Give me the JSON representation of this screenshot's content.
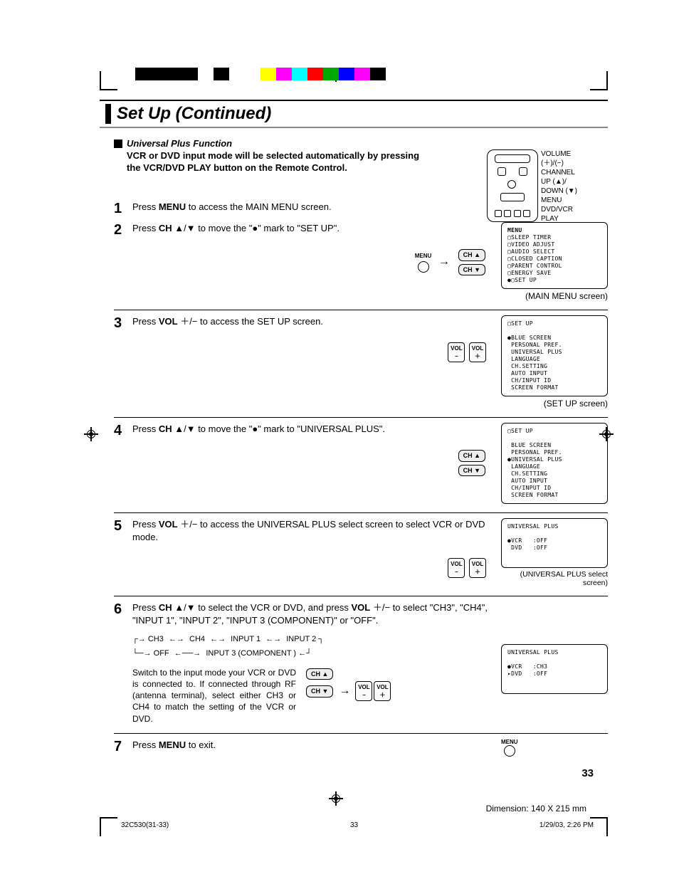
{
  "title": "Set Up (Continued)",
  "section": {
    "heading": "Universal Plus Function",
    "intro": "VCR or DVD input mode will be selected automatically by pressing the VCR/DVD PLAY button on the Remote Control."
  },
  "remote_labels": {
    "l1": "VOLUME",
    "l2": "(＋)/(−)",
    "l3": "CHANNEL",
    "l4": "UP (▲)/",
    "l5": "DOWN (▼)",
    "l6": "MENU",
    "l7": "DVD/VCR",
    "l8": "PLAY"
  },
  "steps": {
    "s1": {
      "num": "1",
      "pre": "Press ",
      "key": "MENU",
      "post": " to access the MAIN MENU screen."
    },
    "s2": {
      "num": "2",
      "pre": "Press ",
      "key": "CH",
      "mid": " ▲/▼ to move the \"●\" mark to \"SET UP\"."
    },
    "s2_controls": {
      "menu": "MENU",
      "chup": "CH ▲",
      "chdown": "CH ▼"
    },
    "s3": {
      "num": "3",
      "pre": "Press ",
      "key": "VOL",
      "post": " ＋/− to access the SET UP screen."
    },
    "s3_controls": {
      "volminus_top": "VOL",
      "volminus_bot": "−",
      "volplus_top": "VOL",
      "volplus_bot": "＋"
    },
    "s4": {
      "num": "4",
      "pre": "Press ",
      "key": "CH",
      "post": " ▲/▼ to move the \"●\" mark to \"UNIVERSAL PLUS\"."
    },
    "s5": {
      "num": "5",
      "pre": "Press ",
      "key": "VOL",
      "post": " ＋/− to access the UNIVERSAL PLUS select screen to select VCR or DVD mode."
    },
    "s6": {
      "num": "6",
      "pre": "Press ",
      "key1": "CH",
      "mid1": " ▲/▼ to select the VCR or DVD, and press ",
      "key2": "VOL",
      "mid2": " ＋/− to select \"CH3\", \"CH4\", \"INPUT 1\", \"INPUT 2\", \"INPUT 3 (COMPONENT)\" or \"OFF\"."
    },
    "s6_flow": {
      "row1_a": "CH3",
      "row1_b": "CH4",
      "row1_c": "INPUT 1",
      "row1_d": "INPUT 2",
      "row2_a": "OFF",
      "row2_b": "INPUT 3 (COMPONENT )"
    },
    "s6_note": "Switch to the input mode your VCR or DVD is connected to. If connected through RF (antenna terminal), select either CH3 or CH4 to match the setting of the VCR or DVD.",
    "s7": {
      "num": "7",
      "pre": "Press ",
      "key": "MENU",
      "post": " to exit."
    }
  },
  "screens": {
    "menu": {
      "title": "MENU",
      "body": "▢SLEEP TIMER\n▢VIDEO ADJUST\n▢AUDIO SELECT\n▢CLOSED CAPTION\n▢PARENT CONTROL\n▢ENERGY SAVE\n●▢SET UP",
      "caption": "(MAIN MENU screen)"
    },
    "setup1": {
      "title": "▢SET UP",
      "body": "●BLUE SCREEN\n PERSONAL PREF.\n UNIVERSAL PLUS\n LANGUAGE\n CH.SETTING\n AUTO INPUT\n CH/INPUT ID\n SCREEN FORMAT",
      "caption": "(SET UP screen)"
    },
    "setup2": {
      "title": "▢SET UP",
      "body": " BLUE SCREEN\n PERSONAL PREF.\n●UNIVERSAL PLUS\n LANGUAGE\n CH.SETTING\n AUTO INPUT\n CH/INPUT ID\n SCREEN FORMAT",
      "caption": ""
    },
    "univ1": {
      "title": "UNIVERSAL PLUS",
      "body": "●VCR   :OFF\n DVD   :OFF",
      "caption": "(UNIVERSAL PLUS select screen)"
    },
    "univ2": {
      "title": "UNIVERSAL PLUS",
      "body": "●VCR   :CH3\n▸DVD   :OFF",
      "caption": ""
    }
  },
  "page_number": "33",
  "footer": {
    "left": "32C530(31-33)",
    "mid": "33",
    "right": "1/29/03, 2:26 PM"
  },
  "dimension": "Dimension: 140  X 215 mm",
  "colorbar": [
    "#000",
    "#000",
    "#000",
    "#000",
    "#fff",
    "#000",
    "#fff",
    "#fff",
    "#ff0",
    "#f0f",
    "#0ff",
    "#f00",
    "#0a0",
    "#00f",
    "#f0f",
    "#000"
  ]
}
